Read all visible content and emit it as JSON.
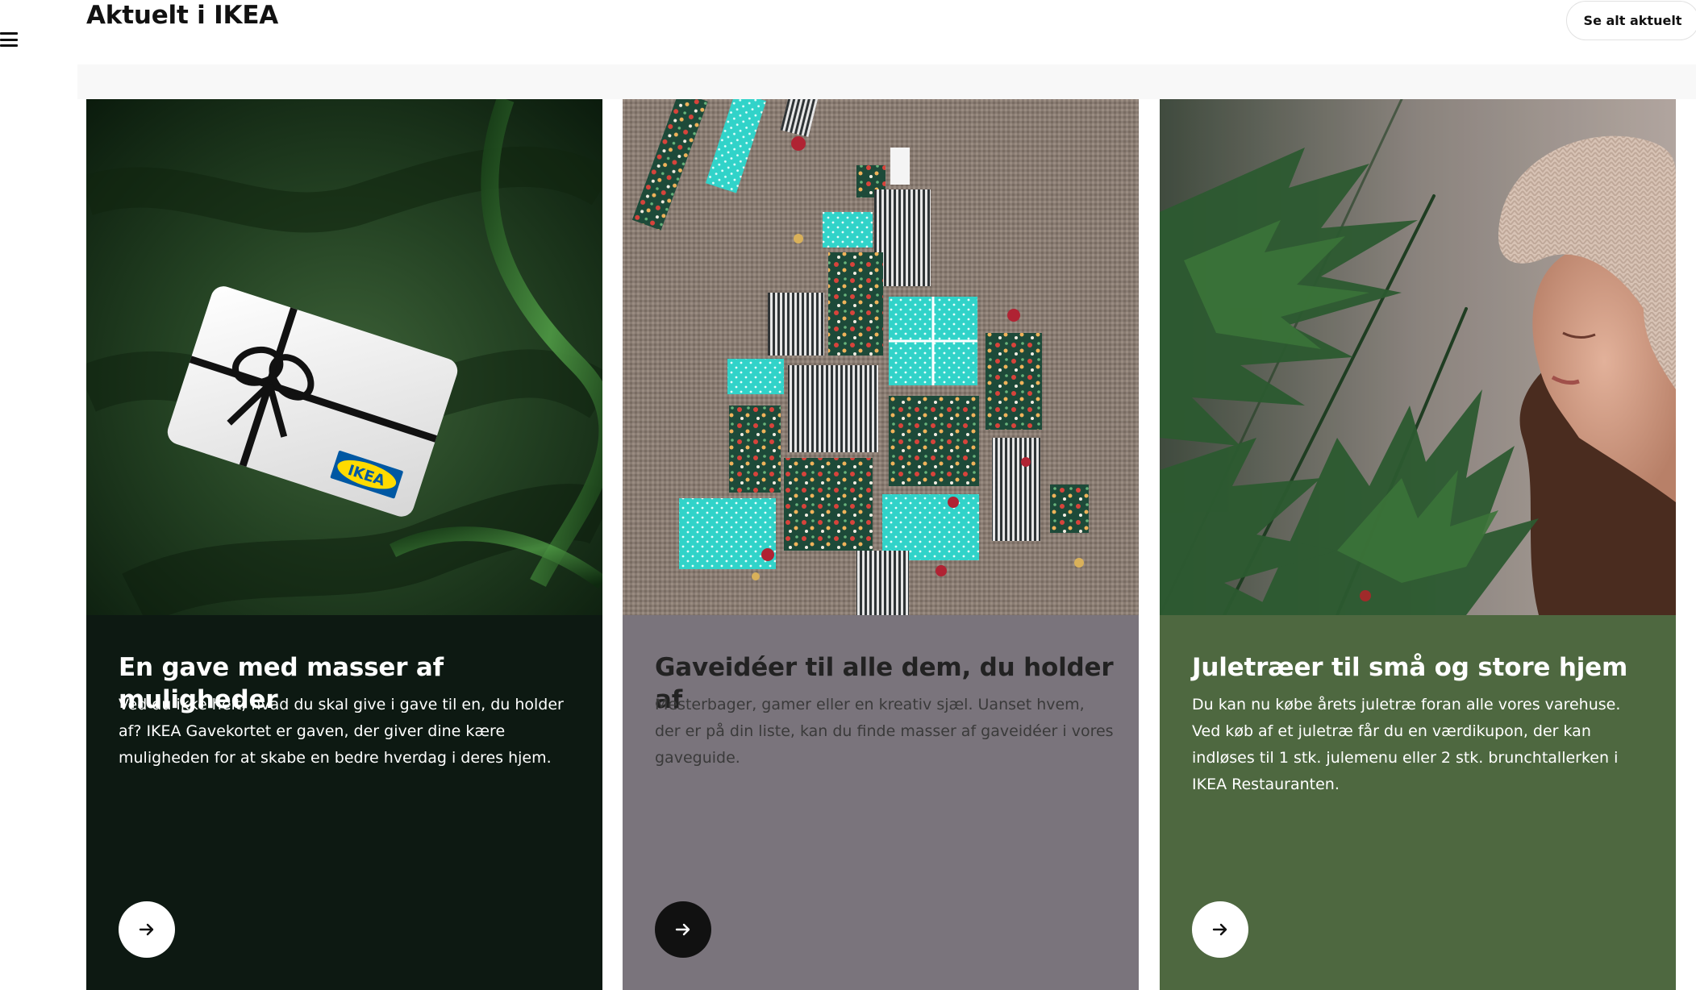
{
  "header": {
    "title": "Aktuelt i IKEA",
    "see_all_label": "Se alt aktuelt",
    "menu_icon": "hamburger-menu-icon"
  },
  "cards": [
    {
      "title": "En gave med masser af muligheder",
      "text": "Ved du ikke helt, hvad du skal give i gave til en, du holder af? IKEA Gavekortet er gaven, der giver dine kære muligheden for at skabe en bedre hverdag i deres hjem.",
      "image": "ikea-gift-card-on-green-velvet",
      "background": "#0d1912",
      "arrow_icon": "arrow-right-icon"
    },
    {
      "title": "Gaveidéer til alle dem, du holder af",
      "text": "Mesterbager, gamer eller en kreativ sjæl. Uanset hvem, der er på din liste, kan du finde masser af gaveidéer i vores gaveguide.",
      "image": "wrapped-gifts-arranged-as-christmas-tree",
      "background": "#7a747c",
      "arrow_icon": "arrow-right-icon"
    },
    {
      "title": "Juletræer til små og store hjem",
      "text": "Du kan nu købe årets juletræ foran alle vores varehuse. Ved køb af et juletræ får du en værdikupon, der kan indløses til 1 stk. julemenu eller 2 stk. brunchtallerken i IKEA Restauranten.",
      "image": "woman-smelling-christmas-tree",
      "background": "#4e6840",
      "arrow_icon": "arrow-right-icon"
    }
  ],
  "image_labels": {
    "gift_card_logo": "IKEA"
  }
}
